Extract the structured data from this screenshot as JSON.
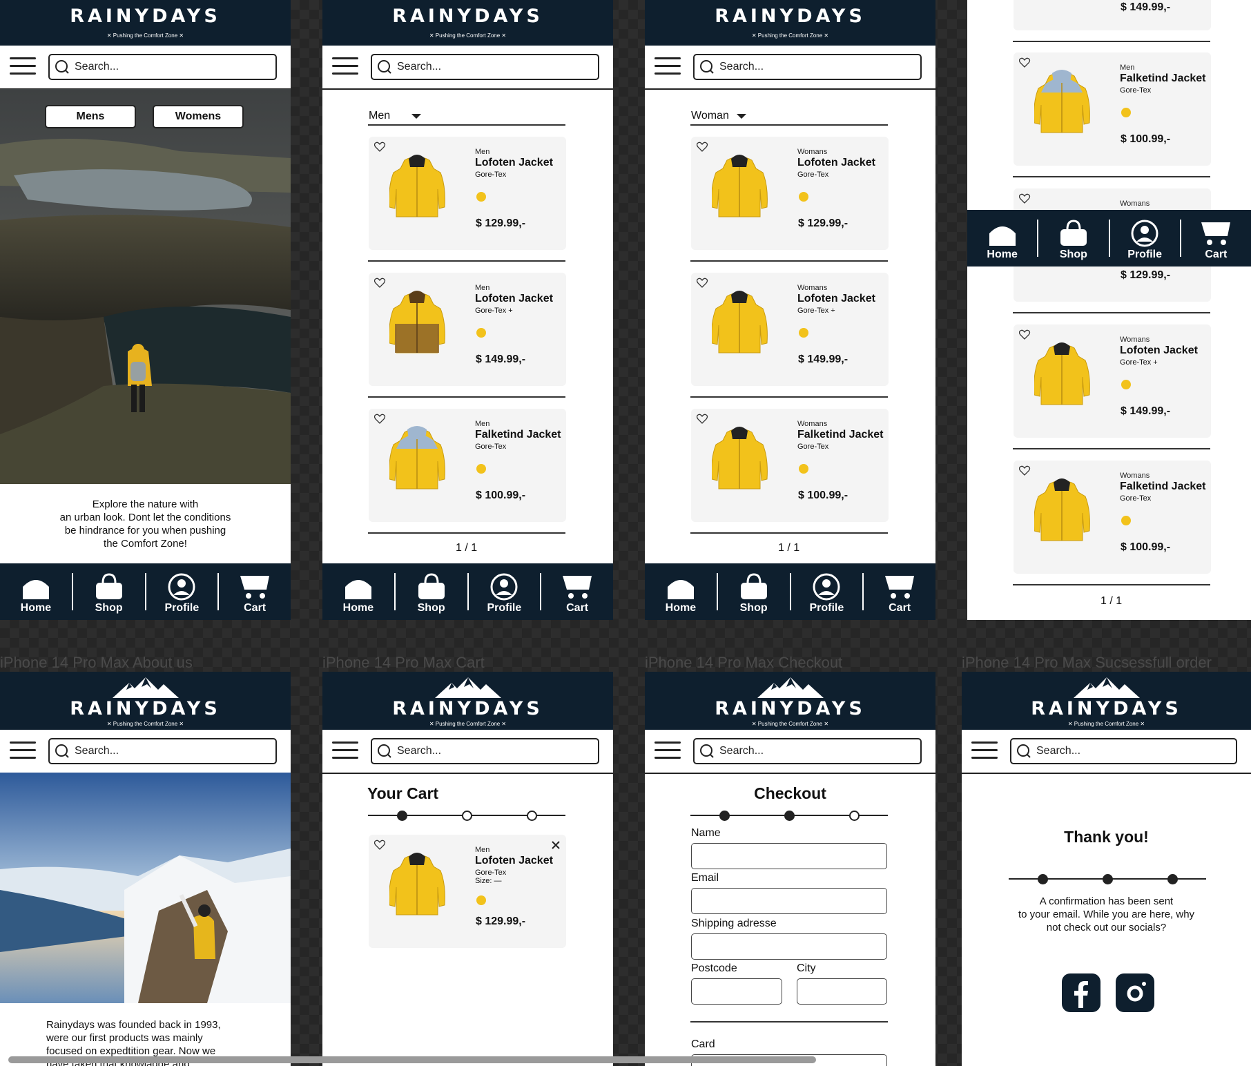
{
  "brand": {
    "name": "RAINYDAYS",
    "tagline": "✕ Pushing the Comfort Zone ✕"
  },
  "search": {
    "placeholder": "Search..."
  },
  "nav": {
    "home": "Home",
    "shop": "Shop",
    "profile": "Profile",
    "cart": "Cart"
  },
  "colors": {
    "header": "#0e1f2e",
    "accent": "#f2c21b",
    "card": "#f4f4f4"
  },
  "frame_labels": {
    "about": "iPhone 14 Pro Max About us",
    "cart": "iPhone 14 Pro Max Cart",
    "checkout": "iPhone 14 Pro Max Checkout",
    "success": "iPhone 14 Pro Max Sucsessfull order"
  },
  "home": {
    "buttons": {
      "mens": "Mens",
      "womens": "Womens"
    },
    "blurb_lines": [
      "Explore the nature with",
      "an urban look. Dont let the conditions",
      "be hindrance for you when pushing",
      "the Comfort Zone!"
    ]
  },
  "mens": {
    "filter": "Men",
    "products": [
      {
        "gender": "Men",
        "name": "Lofoten Jacket",
        "material": "Gore-Tex",
        "price": "$ 129.99,-"
      },
      {
        "gender": "Men",
        "name": "Lofoten Jacket",
        "material": "Gore-Tex +",
        "price": "$ 149.99,-"
      },
      {
        "gender": "Men",
        "name": "Falketind Jacket",
        "material": "Gore-Tex",
        "price": "$ 100.99,-"
      }
    ],
    "pager": "1 / 1"
  },
  "womens": {
    "filter": "Woman",
    "products": [
      {
        "gender": "Womans",
        "name": "Lofoten Jacket",
        "material": "Gore-Tex",
        "price": "$ 129.99,-"
      },
      {
        "gender": "Womans",
        "name": "Lofoten Jacket",
        "material": "Gore-Tex +",
        "price": "$ 149.99,-"
      },
      {
        "gender": "Womans",
        "name": "Falketind Jacket",
        "material": "Gore-Tex",
        "price": "$ 100.99,-"
      }
    ],
    "pager": "1 / 1"
  },
  "scrolled": {
    "top_price": "$ 149.99,-",
    "products": [
      {
        "gender": "Men",
        "name": "Falketind Jacket",
        "material": "Gore-Tex",
        "price": "$ 100.99,-"
      },
      {
        "gender": "Womans",
        "price": "$ 129.99,-"
      },
      {
        "gender": "Womans",
        "name": "Lofoten Jacket",
        "material": "Gore-Tex +",
        "price": "$ 149.99,-"
      },
      {
        "gender": "Womans",
        "name": "Falketind Jacket",
        "material": "Gore-Tex",
        "price": "$ 100.99,-"
      }
    ],
    "pager": "1 / 1"
  },
  "about": {
    "blurb_lines": [
      "Rainydays was founded back in 1993,",
      "were our first products was mainly",
      "focused on expedtition gear. Now we",
      "have taken that knowladge and"
    ]
  },
  "cart": {
    "title": "Your Cart",
    "step": 1,
    "item": {
      "gender": "Men",
      "name": "Lofoten Jacket",
      "material": "Gore-Tex",
      "size": "Size: —",
      "price": "$ 129.99,-"
    }
  },
  "checkout": {
    "title": "Checkout",
    "step": 2,
    "fields": {
      "name": "Name",
      "email": "Email",
      "shipping": "Shipping adresse",
      "postcode": "Postcode",
      "city": "City",
      "card": "Card"
    }
  },
  "success": {
    "title": "Thank you!",
    "step": 3,
    "message_lines": [
      "A confirmation has been sent",
      "to your email. While you are here, why",
      "not check out our socials?"
    ],
    "socials": [
      "facebook-icon",
      "instagram-icon"
    ]
  }
}
